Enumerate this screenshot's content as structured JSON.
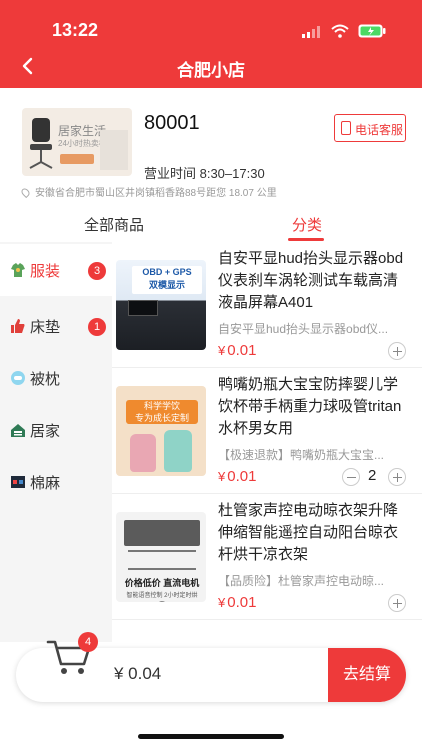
{
  "status": {
    "time": "13:22"
  },
  "nav": {
    "title": "合肥小店"
  },
  "store": {
    "thumb_title": "居家生活",
    "thumb_sub": "24小时热卖榜",
    "name": "80001",
    "phone_label": "电话客服",
    "hours": "营业时间 8:30–17:30",
    "address": "安徽省合肥市蜀山区井岗镇稻香路88号距您 18.07 公里"
  },
  "tabs": {
    "all": "全部商品",
    "category": "分类"
  },
  "sidebar": {
    "items": [
      {
        "label": "服装",
        "badge": "3",
        "icon": "clothing-icon"
      },
      {
        "label": "床垫",
        "badge": "1",
        "icon": "thumbs-up-icon"
      },
      {
        "label": "被枕",
        "badge": "",
        "icon": "pillow-icon"
      },
      {
        "label": "居家",
        "badge": "",
        "icon": "home-icon"
      },
      {
        "label": "棉麻",
        "badge": "",
        "icon": "linen-icon"
      }
    ]
  },
  "products": [
    {
      "name": "自安平显hud抬头显示器obd仪表刹车涡轮测试车载高清液晶屏幕A401",
      "desc": "自安平显hud抬头显示器obd仪...",
      "currency": "¥",
      "price": "0.01",
      "qty": "",
      "image_text": "OBD + GPS\n双模显示"
    },
    {
      "name": "鸭嘴奶瓶大宝宝防摔婴儿学饮杯带手柄重力球吸管tritan水杯男女用",
      "desc": "【极速退款】鸭嘴奶瓶大宝宝...",
      "currency": "¥",
      "price": "0.01",
      "qty": "2",
      "image_text": "科学学饮\n专为成长定制"
    },
    {
      "name": "杜管家声控电动晾衣架升降伸缩智能遥控自动阳台晾衣杆烘干凉衣架",
      "desc": "【品质险】杜管家声控电动晾...",
      "currency": "¥",
      "price": "0.01",
      "qty": "",
      "image_text": "价格低价  直流电机",
      "image_sub": "智能语音控制 2小时定时烘干"
    }
  ],
  "cart": {
    "badge": "4",
    "total": "¥ 0.04",
    "checkout": "去结算"
  },
  "colors": {
    "accent": "#ee3a3a"
  }
}
